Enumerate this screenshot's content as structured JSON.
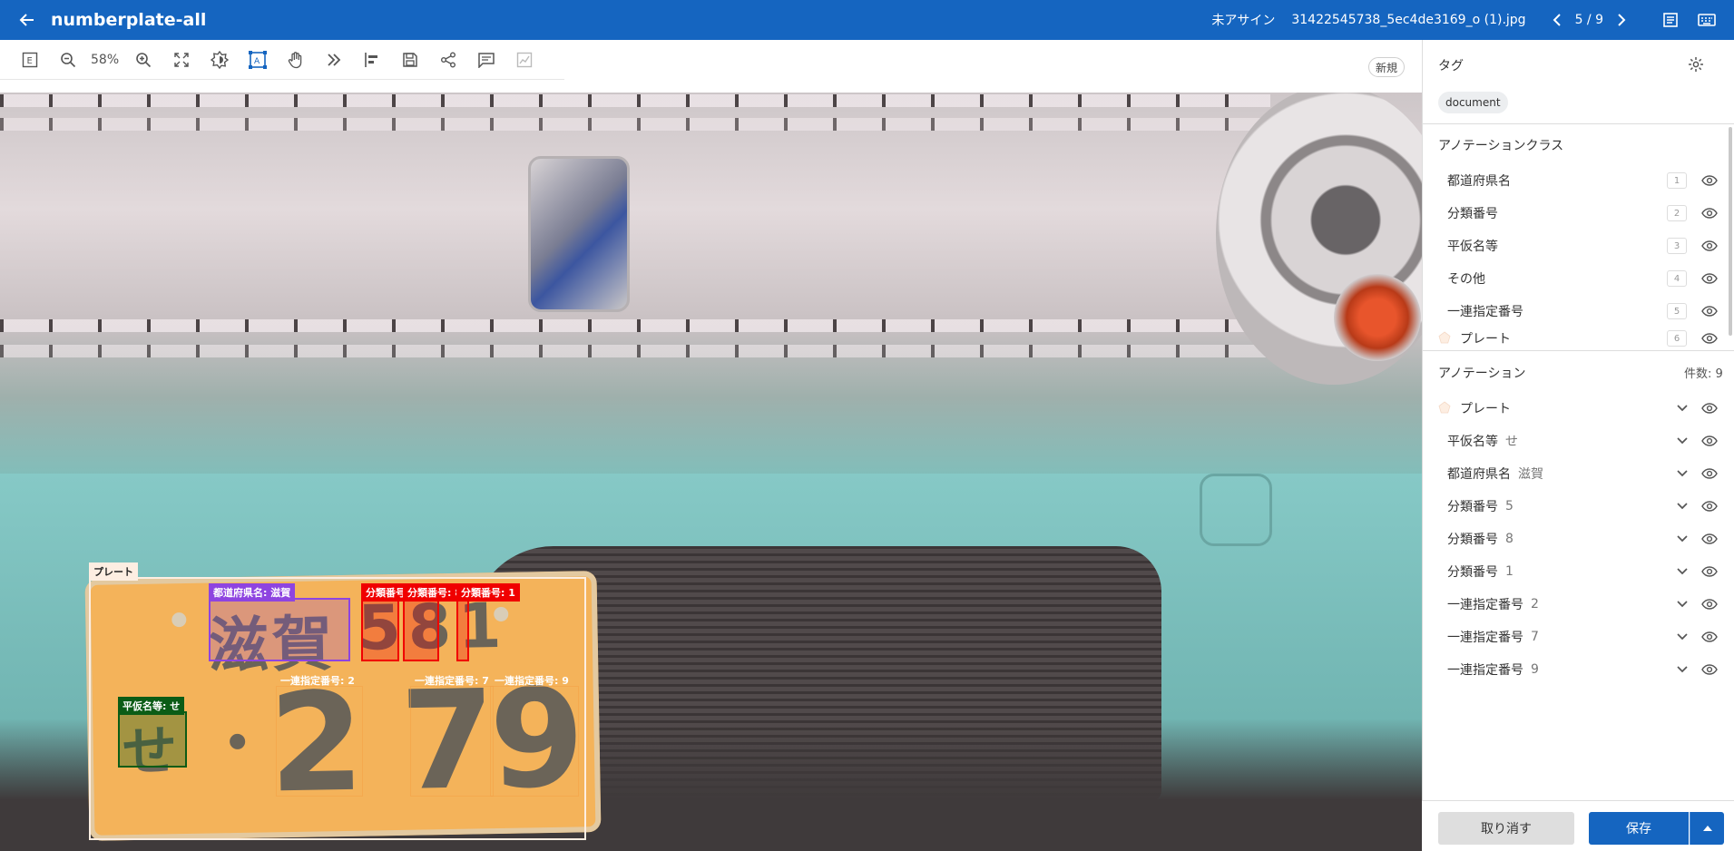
{
  "app": {
    "title": "numberplate-all",
    "assign_status": "未アサイン",
    "file_name": "31422545738_5ec4de3169_o (1).jpg",
    "pager": "5 / 9"
  },
  "toolbar": {
    "zoom": "58%",
    "new_badge": "新規"
  },
  "panel": {
    "tags_title": "タグ",
    "tags": [
      "document"
    ],
    "classes_title": "アノテーションクラス",
    "classes": [
      {
        "label": "都道府県名",
        "color": "#8e44e0",
        "hotkey": "1"
      },
      {
        "label": "分類番号",
        "color": "#f00000",
        "hotkey": "2"
      },
      {
        "label": "平仮名等",
        "color": "#0b5c16",
        "hotkey": "3"
      },
      {
        "label": "その他",
        "color": "#b0904a",
        "hotkey": "4"
      },
      {
        "label": "一連指定番号",
        "color": "#f4b35a",
        "hotkey": "5"
      },
      {
        "label": "プレート",
        "color": "#fdeee2",
        "hotkey": "6"
      }
    ],
    "annotations_title": "アノテーション",
    "annotations_count": "件数: 9",
    "annotations": [
      {
        "label": "プレート",
        "value": "",
        "color": "#fdeee2"
      },
      {
        "label": "平仮名等",
        "value": "せ",
        "color": "#0b5c16"
      },
      {
        "label": "都道府県名",
        "value": "滋賀",
        "color": "#8e44e0"
      },
      {
        "label": "分類番号",
        "value": "5",
        "color": "#f00000"
      },
      {
        "label": "分類番号",
        "value": "8",
        "color": "#f00000"
      },
      {
        "label": "分類番号",
        "value": "1",
        "color": "#f00000"
      },
      {
        "label": "一連指定番号",
        "value": "2",
        "color": "#f4b35a"
      },
      {
        "label": "一連指定番号",
        "value": "7",
        "color": "#f4b35a"
      },
      {
        "label": "一連指定番号",
        "value": "9",
        "color": "#f4b35a"
      }
    ],
    "cancel_label": "取り消す",
    "save_label": "保存"
  },
  "canvas": {
    "labels": {
      "plate": "プレート",
      "pref": "都道府県名: 滋賀",
      "cls5": "分類番号: 5",
      "cls8": "分類番号: 8",
      "cls1": "分類番号: 1",
      "kana": "平仮名等: せ",
      "ser2": "一連指定番号: 2",
      "ser7": "一連指定番号: 7",
      "ser9": "一連指定番号: 9"
    },
    "plate_text": {
      "pref": "滋賀",
      "cls": "581",
      "kana": "せ",
      "dot": "・",
      "ser": "2 79"
    }
  }
}
